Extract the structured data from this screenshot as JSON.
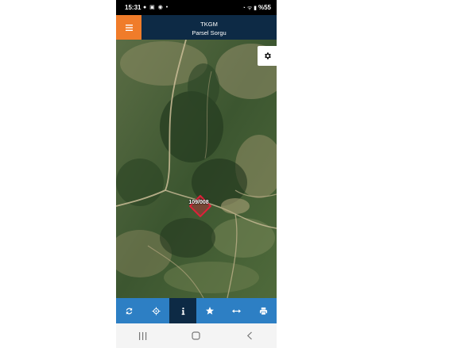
{
  "status_bar": {
    "time": "15:31",
    "notifications": "● ▣ ◉ •",
    "signals": "◔ ᯤ ▮",
    "battery": "%55"
  },
  "app_bar": {
    "title": "TKGM",
    "subtitle": "Parsel Sorgu",
    "menu_icon": "hamburger-icon"
  },
  "map": {
    "parcel_label": "109/008",
    "settings_icon": "gear-icon",
    "parcel_color": "#e0203a"
  },
  "toolbar": {
    "items": [
      {
        "name": "refresh",
        "icon": "refresh-icon",
        "active": false
      },
      {
        "name": "locate",
        "icon": "crosshair-icon",
        "active": false
      },
      {
        "name": "info",
        "icon": "info-icon",
        "active": true
      },
      {
        "name": "favorites",
        "icon": "star-icon",
        "active": false
      },
      {
        "name": "measure",
        "icon": "measure-icon",
        "active": false
      },
      {
        "name": "print",
        "icon": "print-icon",
        "active": false
      }
    ]
  },
  "navigation_bar": {
    "recent_icon": "recent-apps-icon",
    "home_icon": "home-icon",
    "back_icon": "back-icon"
  },
  "colors": {
    "app_bar": "#0d2a45",
    "menu_button": "#f07c2a",
    "toolbar": "#2d7fc4",
    "toolbar_active": "#0d2a45"
  }
}
